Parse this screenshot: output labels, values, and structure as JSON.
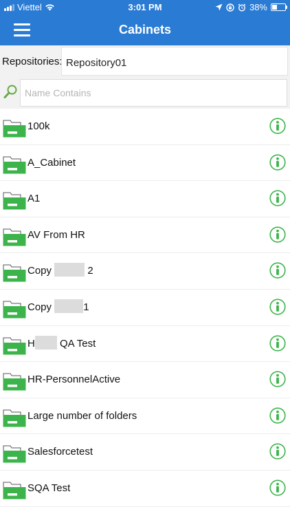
{
  "status_bar": {
    "carrier": "Viettel",
    "time": "3:01 PM",
    "battery": "38%",
    "battery_level": 0.38,
    "signal_icon": "signal-icon",
    "wifi_icon": "wifi-icon",
    "location_icon": "location-icon",
    "lock_icon": "rotation-lock-icon",
    "alarm_icon": "alarm-icon"
  },
  "header": {
    "title": "Cabinets",
    "menu_icon": "hamburger-icon",
    "color": "#2a7bd3"
  },
  "repository": {
    "label": "Repositories:",
    "value": "Repository01"
  },
  "search": {
    "placeholder": "Name Contains",
    "value": "",
    "icon": "search-icon"
  },
  "cabinets": [
    {
      "name": "100k"
    },
    {
      "name": "A_Cabinet"
    },
    {
      "name": "A1"
    },
    {
      "name": "AV From HR"
    },
    {
      "name_before": "Copy ",
      "name_after": " 2",
      "redacted": true
    },
    {
      "name_before": "Copy ",
      "name_after": "1",
      "redacted": true
    },
    {
      "name_before": "H",
      "name_after": " QA Test",
      "redacted": true
    },
    {
      "name": "HR-PersonnelActive"
    },
    {
      "name": "Large number of folders"
    },
    {
      "name": "Salesforcetest"
    },
    {
      "name": "SQA Test"
    }
  ],
  "colors": {
    "folder": "#3cb44b",
    "info": "#3cb44b",
    "accent": "#2a7bd3"
  },
  "icons": {
    "folder": "folder-icon",
    "info": "info-icon"
  }
}
